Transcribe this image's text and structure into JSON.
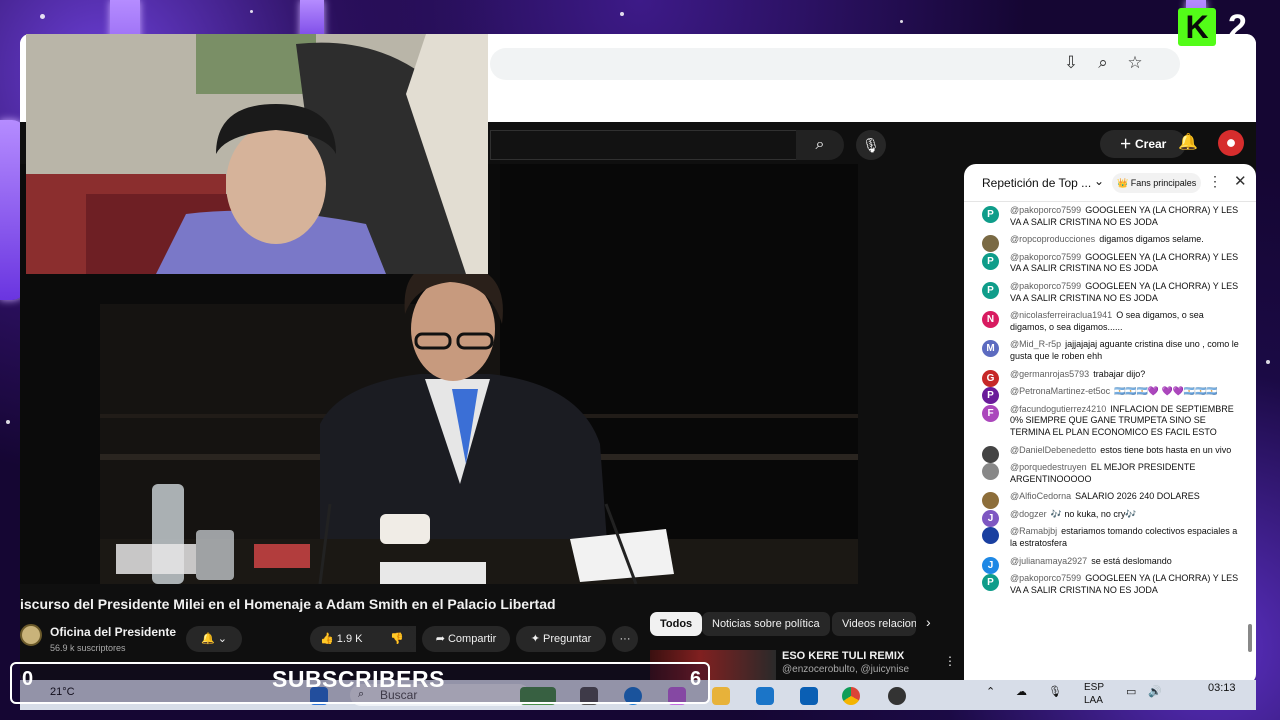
{
  "youtube": {
    "create_label": "Crear",
    "video_title": "iscurso del Presidente Milei en el Homenaje a Adam Smith en el Palacio Libertad",
    "channel_name": "Oficina del Presidente",
    "subscribers": "56.9 k suscriptores",
    "likes": "1.9 K",
    "share_label": "Compartir",
    "ask_label": "Preguntar",
    "more_label": "···",
    "chips": [
      "Todos",
      "Noticias sobre política",
      "Videos relacion"
    ],
    "recommended": {
      "title": "ESO KERE TULI REMIX",
      "channel": "@enzocerobulto, @juicynise"
    }
  },
  "chat": {
    "title": "Repetición de Top ...",
    "fans_label": "Fans principales",
    "messages": [
      {
        "author": "@pakoporco7599",
        "text": "GOOGLEEN YA (LA CHORRA) Y LES VA A SALIR CRISTINA NO ES JODA",
        "initial": "P",
        "color": "#0f9d8a"
      },
      {
        "author": "@ropcoproducciones",
        "text": "digamos digamos selame.",
        "initial": "",
        "color": "#7a6a44"
      },
      {
        "author": "@pakoporco7599",
        "text": "GOOGLEEN YA (LA CHORRA) Y LES VA A SALIR CRISTINA NO ES JODA",
        "initial": "P",
        "color": "#0f9d8a"
      },
      {
        "author": "@pakoporco7599",
        "text": "GOOGLEEN YA (LA CHORRA) Y LES VA A SALIR CRISTINA NO ES JODA",
        "initial": "P",
        "color": "#0f9d8a"
      },
      {
        "author": "@nicolasferreiraclua1941",
        "text": "O sea digamos, o sea digamos, o sea digamos......",
        "initial": "N",
        "color": "#d81b60"
      },
      {
        "author": "@Mid_R-r5p",
        "text": "jajjajajaj aguante cristina dise uno , como le gusta que le roben ehh",
        "initial": "M",
        "color": "#5c6bc0"
      },
      {
        "author": "@germanrojas5793",
        "text": "trabajar dijo?",
        "initial": "G",
        "color": "#c62828"
      },
      {
        "author": "@PetronaMartinez-et5oc",
        "text": "🇦🇷🇦🇷🇦🇷💜 💜💜🇦🇷🇦🇷🇦🇷",
        "initial": "P",
        "color": "#6a1b9a"
      },
      {
        "author": "@facundogutierrez4210",
        "text": "INFLACION DE SEPTIEMBRE 0% SIEMPRE QUE GANE TRUMPETA SINO SE TERMINA EL PLAN ECONOMICO ES FACIL ESTO",
        "initial": "F",
        "color": "#ab47bc"
      },
      {
        "author": "@DanielDebenedetto",
        "text": "estos tiene bots hasta en un vivo",
        "initial": "",
        "color": "#444"
      },
      {
        "author": "@porquedestruyen",
        "text": "EL MEJOR PRESIDENTE ARGENTINOOOOO",
        "initial": "",
        "color": "#888"
      },
      {
        "author": "@AlfioCedorna",
        "text": "SALARIO 2026 240 DOLARES",
        "initial": "",
        "color": "#8d6e3a"
      },
      {
        "author": "@dogzer",
        "text": "🎶 no kuka, no cry🎶",
        "initial": "J",
        "color": "#7e57c2"
      },
      {
        "author": "@Ramabjbj",
        "text": "estariamos tomando colectivos espaciales a la estratosfera",
        "initial": "",
        "color": "#1a3fa0"
      },
      {
        "author": "@julianamaya2927",
        "text": "se está deslomando",
        "initial": "J",
        "color": "#1e88e5"
      },
      {
        "author": "@pakoporco7599",
        "text": "GOOGLEEN YA (LA CHORRA) Y LES VA A SALIR CRISTINA NO ES JODA",
        "initial": "P",
        "color": "#0f9d8a"
      }
    ]
  },
  "taskbar": {
    "weather": "21°C",
    "search_placeholder": "Buscar",
    "lang": "ESP",
    "layout": "LAA",
    "time": "03:13"
  },
  "overlay": {
    "sub_count": "0",
    "sub_label": "SUBSCRIBERS",
    "sub_goal": "6",
    "kick_logo": "K",
    "kick_number": "2"
  }
}
